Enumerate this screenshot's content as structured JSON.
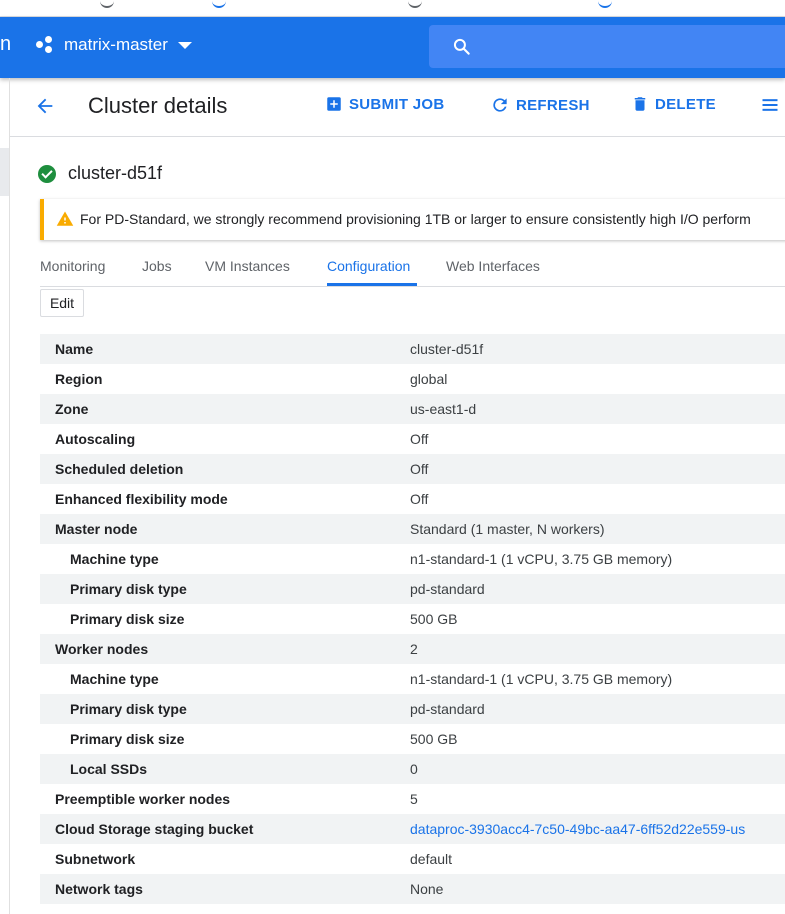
{
  "app": {
    "brand_tail": "n",
    "project_name": "matrix-master",
    "search_placeholder": ""
  },
  "header": {
    "title": "Cluster details",
    "actions": [
      {
        "label": "SUBMIT JOB",
        "icon": "add-box-icon"
      },
      {
        "label": "REFRESH",
        "icon": "refresh-icon"
      },
      {
        "label": "DELETE",
        "icon": "delete-icon"
      }
    ]
  },
  "cluster": {
    "name": "cluster-d51f",
    "status_icon": "check-circle-icon",
    "status_color": "#1e8e3e"
  },
  "warning": {
    "text": "For PD-Standard, we strongly recommend provisioning 1TB or larger to ensure consistently high I/O perform",
    "color": "#f9ab00"
  },
  "tabs": [
    {
      "label": "Monitoring",
      "active": false
    },
    {
      "label": "Jobs",
      "active": false
    },
    {
      "label": "VM Instances",
      "active": false
    },
    {
      "label": "Configuration",
      "active": true
    },
    {
      "label": "Web Interfaces",
      "active": false
    }
  ],
  "edit_label": "Edit",
  "config_rows": [
    {
      "key": "Name",
      "value": "cluster-d51f"
    },
    {
      "key": "Region",
      "value": "global"
    },
    {
      "key": "Zone",
      "value": "us-east1-d"
    },
    {
      "key": "Autoscaling",
      "value": "Off"
    },
    {
      "key": "Scheduled deletion",
      "value": "Off"
    },
    {
      "key": "Enhanced flexibility mode",
      "value": "Off"
    },
    {
      "key": "Master node",
      "value": "Standard (1 master, N workers)"
    },
    {
      "key": "Machine type",
      "value": "n1-standard-1 (1 vCPU, 3.75 GB memory)",
      "indent": true
    },
    {
      "key": "Primary disk type",
      "value": "pd-standard",
      "indent": true
    },
    {
      "key": "Primary disk size",
      "value": "500 GB",
      "indent": true
    },
    {
      "key": "Worker nodes",
      "value": "2"
    },
    {
      "key": "Machine type",
      "value": "n1-standard-1 (1 vCPU, 3.75 GB memory)",
      "indent": true
    },
    {
      "key": "Primary disk type",
      "value": "pd-standard",
      "indent": true
    },
    {
      "key": "Primary disk size",
      "value": "500 GB",
      "indent": true
    },
    {
      "key": "Local SSDs",
      "value": "0",
      "indent": true
    },
    {
      "key": "Preemptible worker nodes",
      "value": "5"
    },
    {
      "key": "Cloud Storage staging bucket",
      "value": "dataproc-3930acc4-7c50-49bc-aa47-6ff52d22e559-us",
      "link": true
    },
    {
      "key": "Subnetwork",
      "value": "default"
    },
    {
      "key": "Network tags",
      "value": "None"
    }
  ],
  "colors": {
    "topbar": "#1a73e8",
    "accent": "#1a73e8",
    "row_stripe": "#f1f3f4"
  }
}
